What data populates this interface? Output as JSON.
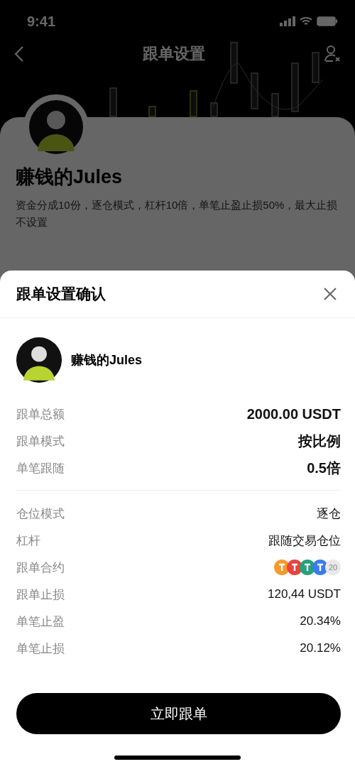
{
  "status_bar": {
    "time": "9:41"
  },
  "page": {
    "title": "跟单设置",
    "trader_name": "赚钱的Jules",
    "description": "资金分成10份，逐仓模式，杠杆10倍，单笔止盈止损50%，最大止损不设置"
  },
  "sheet": {
    "title": "跟单设置确认",
    "trader_name": "赚钱的Jules",
    "summary": [
      {
        "label": "跟单总额",
        "value": "2000.00 USDT"
      },
      {
        "label": "跟单模式",
        "value": "按比例"
      },
      {
        "label": "单笔跟随",
        "value": "0.5倍"
      }
    ],
    "details": [
      {
        "kind": "text",
        "label": "仓位模式",
        "value": "逐仓"
      },
      {
        "kind": "text",
        "label": "杠杆",
        "value": "跟随交易仓位"
      },
      {
        "kind": "coins",
        "label": "跟单合约",
        "coins": [
          {
            "color": "#f39a2c"
          },
          {
            "color": "#e8423f"
          },
          {
            "color": "#26a17b"
          },
          {
            "color": "#3b7be8"
          }
        ],
        "count": "20"
      },
      {
        "kind": "text",
        "label": "跟单止损",
        "value": "120,44 USDT"
      },
      {
        "kind": "text",
        "label": "单笔止盈",
        "value": "20.34%"
      },
      {
        "kind": "text",
        "label": "单笔止损",
        "value": "20.12%"
      }
    ],
    "button": "立即跟单"
  }
}
